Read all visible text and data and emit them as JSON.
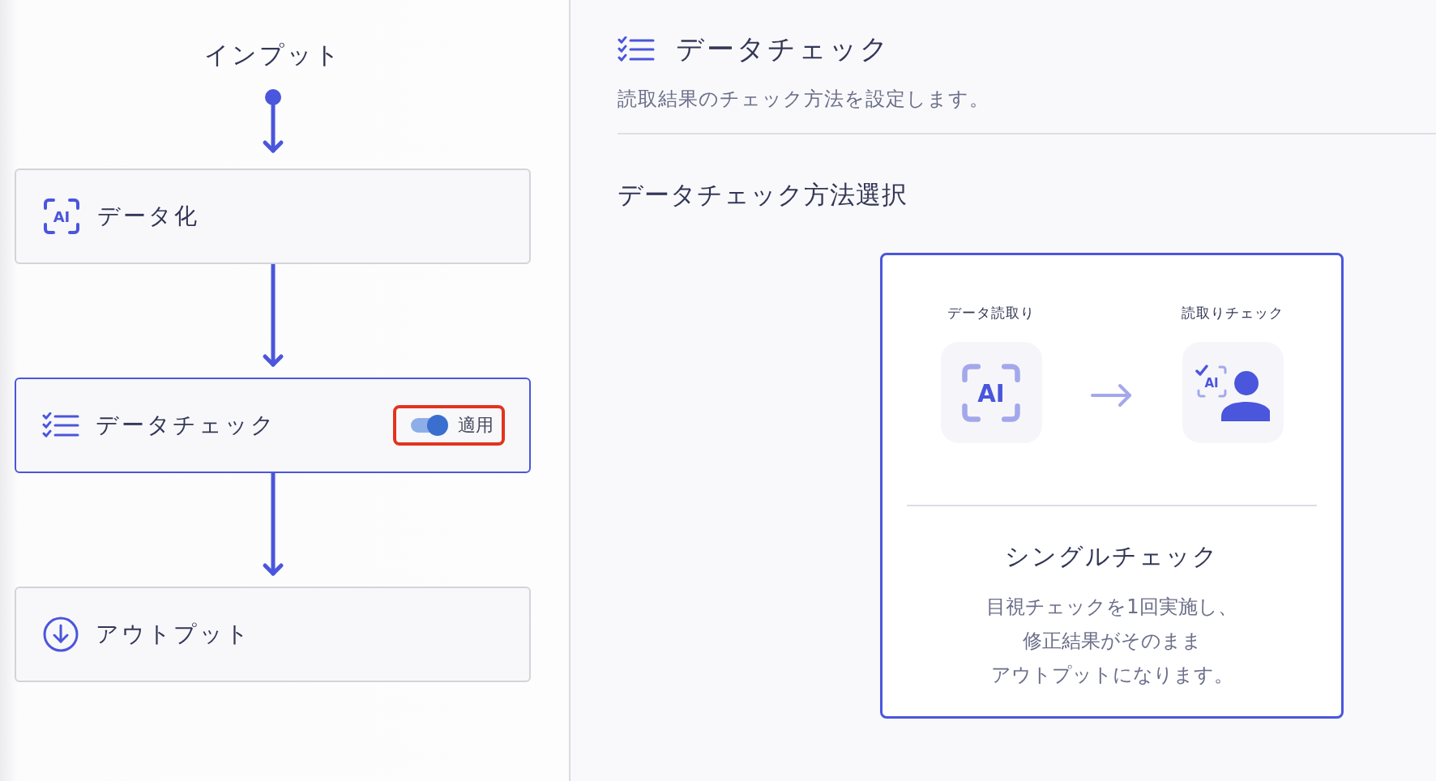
{
  "flow": {
    "start_label": "インプット",
    "steps": [
      {
        "kind": "ai",
        "icon_text": "AI",
        "label": "データ化",
        "selected": false
      },
      {
        "kind": "check",
        "label": "データチェック",
        "selected": true,
        "toggle": {
          "on": true,
          "label": "適用",
          "highlighted": true
        }
      },
      {
        "kind": "output",
        "label": "アウトプット",
        "selected": false
      }
    ]
  },
  "panel": {
    "title": "データチェック",
    "description": "読取結果のチェック方法を設定します。",
    "section_title": "データチェック方法選択",
    "options": [
      {
        "selected": true,
        "stages": [
          {
            "kind": "ai",
            "label": "データ読取り",
            "icon_text": "AI"
          },
          {
            "kind": "human",
            "label": "読取りチェック",
            "icon_text": "AI"
          }
        ],
        "title": "シングルチェック",
        "description": [
          "目視チェックを1回実施し、",
          "修正結果がそのまま",
          "アウトプットになります。"
        ]
      }
    ]
  }
}
